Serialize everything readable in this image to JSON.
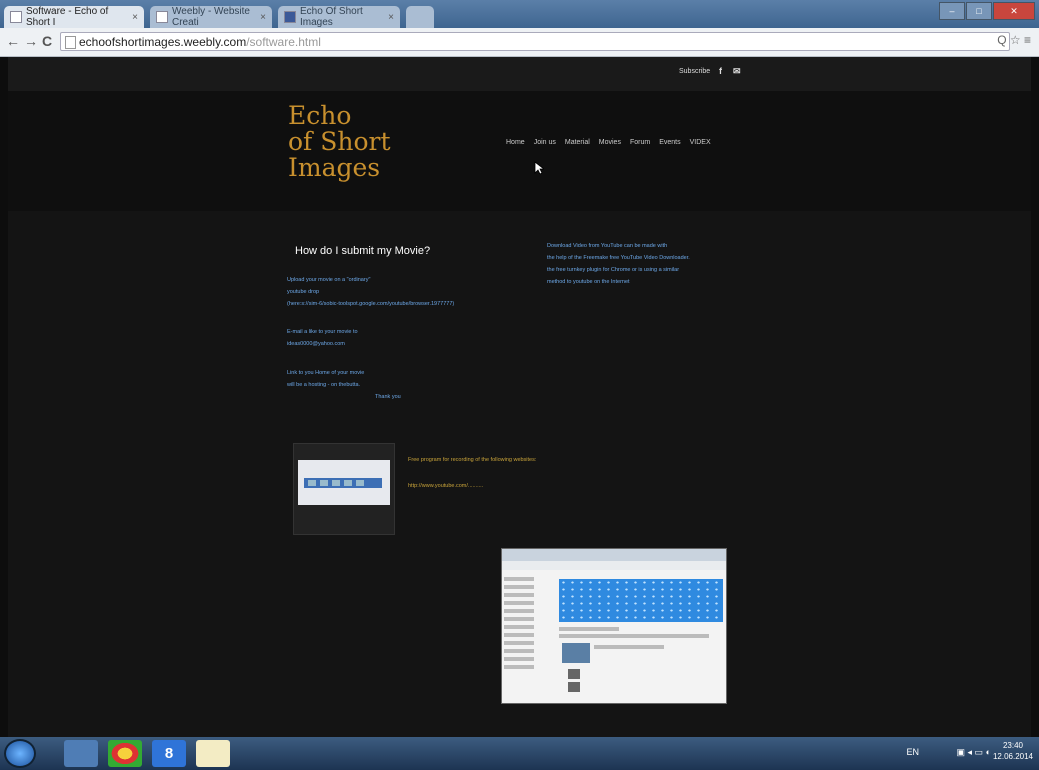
{
  "browser": {
    "tabs": [
      {
        "label": "Software - Echo of Short I",
        "close": "×"
      },
      {
        "label": "Weebly - Website Creati",
        "close": "×"
      },
      {
        "label": "Echo Of Short Images",
        "close": "×"
      }
    ],
    "back": "←",
    "forward": "→",
    "reload": "C",
    "url_host": "echoofshortimages.weebly.com",
    "url_path": "/software.html",
    "window_buttons": [
      "–",
      "□",
      "✕"
    ],
    "right_icons": "Q ☆ ≡"
  },
  "site": {
    "subscribe": "Subscribe",
    "social": [
      "f",
      "✉"
    ],
    "logo": [
      "Echo",
      "of Short",
      "Images"
    ],
    "nav": [
      "Home",
      "Join us",
      "Material",
      "Movies",
      "Forum",
      "Events",
      "VIDEX"
    ],
    "heading": "How do I submit my Movie?",
    "left_paragraphs": [
      [
        "Upload your movie on a \"ordinary\"",
        "youtube drop",
        "(here:s://sim-6/sobic-toolspot.google.com/youtube/browser.1977777)"
      ],
      [
        "E-mail a like to your movie to",
        "ideas0000@yahoo.com"
      ],
      [
        "Link to you Home of your movie",
        "will be a hosting - on thebutta.",
        "Thank you"
      ]
    ],
    "right_paragraph": [
      "Download Video from YouTube can be made with",
      "the help of the Freemake free YouTube Video Downloader.",
      "the free turnkey plugin for Chrome or is using a similar",
      "method to youtube on the Internet"
    ],
    "video_caption": "Free program for recording of the following websites:",
    "video_link": "http://www.youtube.com/.........."
  },
  "taskbar": {
    "apps": [
      "",
      "8",
      ""
    ],
    "tray": "EN",
    "time": "23:40",
    "date": "12.06.2014"
  }
}
